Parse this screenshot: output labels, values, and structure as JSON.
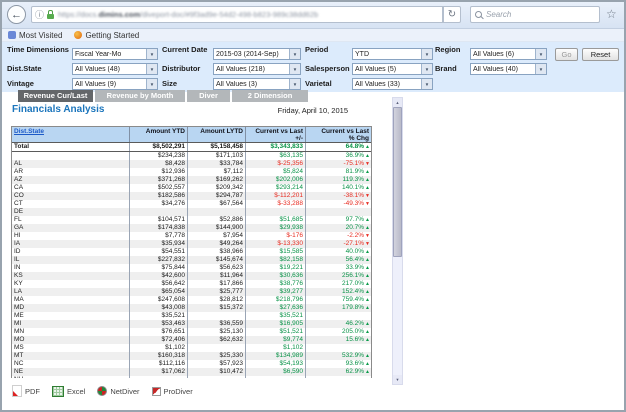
{
  "browser": {
    "url_prefix": "https://docs.",
    "url_domain": "dimins.com",
    "url_rest": "/diveport-doc/#9f3ad9e-54d2-498-b823-989c38dd62b",
    "search_placeholder": "Search",
    "bookmarks": [
      {
        "label": "Most Visited"
      },
      {
        "label": "Getting Started"
      }
    ]
  },
  "filters": {
    "go": "Go",
    "reset": "Reset",
    "rows": [
      {
        "fields": [
          {
            "label": "Time Dimensions",
            "value": "Fiscal Year-Mo"
          },
          {
            "label": "Current Date",
            "value": "2015-03 (2014-Sep)"
          },
          {
            "label": "Period",
            "value": "YTD"
          },
          {
            "label": "Region",
            "value": "All Values (6)"
          }
        ]
      },
      {
        "fields": [
          {
            "label": "Dist.State",
            "value": "All Values (48)"
          },
          {
            "label": "Distributor",
            "value": "All Values (218)"
          },
          {
            "label": "Salesperson",
            "value": "All Values (5)"
          },
          {
            "label": "Brand",
            "value": "All Values (40)"
          }
        ]
      },
      {
        "fields": [
          {
            "label": "Vintage",
            "value": "All Values (9)"
          },
          {
            "label": "Size",
            "value": "All Values (3)"
          },
          {
            "label": "Varietal",
            "value": "All Values (33)"
          }
        ]
      }
    ]
  },
  "tabs": [
    {
      "label": "Revenue Cur/Last",
      "active": true
    },
    {
      "label": "Revenue by Month",
      "active": false
    },
    {
      "label": "Diver",
      "active": false
    },
    {
      "label": "2 Dimension",
      "active": false
    }
  ],
  "page": {
    "title": "Financials Analysis",
    "date": "Friday, April 10, 2015"
  },
  "table": {
    "headers": [
      "Dist.State",
      "Amount YTD",
      "Amount LYTD",
      "Current vs Last\n+/-",
      "Current vs Last\n% Chg"
    ],
    "total": {
      "label": "Total",
      "ytd": "$8,502,291",
      "lytd": "$5,158,458",
      "diff": "$3,343,833",
      "pct": "64.8%",
      "dir": "up"
    },
    "rows": [
      {
        "label": "",
        "ytd": "$234,238",
        "lytd": "$171,103",
        "diff": "$63,135",
        "pct": "36.9%",
        "dir": "up"
      },
      {
        "label": "AL",
        "ytd": "$8,428",
        "lytd": "$33,784",
        "diff": "$-25,356",
        "pct": "-75.1%",
        "dir": "down"
      },
      {
        "label": "AR",
        "ytd": "$12,936",
        "lytd": "$7,112",
        "diff": "$5,824",
        "pct": "81.9%",
        "dir": "up"
      },
      {
        "label": "AZ",
        "ytd": "$371,268",
        "lytd": "$169,262",
        "diff": "$202,006",
        "pct": "119.3%",
        "dir": "up"
      },
      {
        "label": "CA",
        "ytd": "$502,557",
        "lytd": "$209,342",
        "diff": "$293,214",
        "pct": "140.1%",
        "dir": "up"
      },
      {
        "label": "CO",
        "ytd": "$182,586",
        "lytd": "$294,787",
        "diff": "$-112,201",
        "pct": "-38.1%",
        "dir": "down"
      },
      {
        "label": "CT",
        "ytd": "$34,276",
        "lytd": "$67,564",
        "diff": "$-33,288",
        "pct": "-49.3%",
        "dir": "down"
      },
      {
        "label": "DE",
        "ytd": "",
        "lytd": "",
        "diff": "",
        "pct": "",
        "dir": ""
      },
      {
        "label": "FL",
        "ytd": "$104,571",
        "lytd": "$52,886",
        "diff": "$51,685",
        "pct": "97.7%",
        "dir": "up"
      },
      {
        "label": "GA",
        "ytd": "$174,838",
        "lytd": "$144,900",
        "diff": "$29,938",
        "pct": "20.7%",
        "dir": "up"
      },
      {
        "label": "HI",
        "ytd": "$7,778",
        "lytd": "$7,954",
        "diff": "$-176",
        "pct": "-2.2%",
        "dir": "down"
      },
      {
        "label": "IA",
        "ytd": "$35,934",
        "lytd": "$49,264",
        "diff": "$-13,330",
        "pct": "-27.1%",
        "dir": "down"
      },
      {
        "label": "ID",
        "ytd": "$54,551",
        "lytd": "$38,966",
        "diff": "$15,585",
        "pct": "40.0%",
        "dir": "up"
      },
      {
        "label": "IL",
        "ytd": "$227,832",
        "lytd": "$145,674",
        "diff": "$82,158",
        "pct": "56.4%",
        "dir": "up"
      },
      {
        "label": "IN",
        "ytd": "$75,844",
        "lytd": "$56,623",
        "diff": "$19,221",
        "pct": "33.9%",
        "dir": "up"
      },
      {
        "label": "KS",
        "ytd": "$42,600",
        "lytd": "$11,964",
        "diff": "$30,636",
        "pct": "256.1%",
        "dir": "up"
      },
      {
        "label": "KY",
        "ytd": "$56,642",
        "lytd": "$17,866",
        "diff": "$38,776",
        "pct": "217.0%",
        "dir": "up"
      },
      {
        "label": "LA",
        "ytd": "$65,054",
        "lytd": "$25,777",
        "diff": "$39,277",
        "pct": "152.4%",
        "dir": "up"
      },
      {
        "label": "MA",
        "ytd": "$247,608",
        "lytd": "$28,812",
        "diff": "$218,796",
        "pct": "759.4%",
        "dir": "up"
      },
      {
        "label": "MD",
        "ytd": "$43,008",
        "lytd": "$15,372",
        "diff": "$27,636",
        "pct": "179.8%",
        "dir": "up"
      },
      {
        "label": "ME",
        "ytd": "$35,521",
        "lytd": "",
        "diff": "$35,521",
        "pct": "",
        "dir": ""
      },
      {
        "label": "MI",
        "ytd": "$53,463",
        "lytd": "$36,559",
        "diff": "$16,905",
        "pct": "46.2%",
        "dir": "up"
      },
      {
        "label": "MN",
        "ytd": "$76,651",
        "lytd": "$25,130",
        "diff": "$51,521",
        "pct": "205.0%",
        "dir": "up"
      },
      {
        "label": "MO",
        "ytd": "$72,406",
        "lytd": "$62,632",
        "diff": "$9,774",
        "pct": "15.6%",
        "dir": "up"
      },
      {
        "label": "MS",
        "ytd": "$1,102",
        "lytd": "",
        "diff": "$1,102",
        "pct": "",
        "dir": ""
      },
      {
        "label": "MT",
        "ytd": "$160,318",
        "lytd": "$25,330",
        "diff": "$134,989",
        "pct": "532.9%",
        "dir": "up"
      },
      {
        "label": "NC",
        "ytd": "$112,116",
        "lytd": "$57,923",
        "diff": "$54,193",
        "pct": "93.6%",
        "dir": "up"
      },
      {
        "label": "NE",
        "ytd": "$17,062",
        "lytd": "$10,472",
        "diff": "$6,590",
        "pct": "62.9%",
        "dir": "up"
      }
    ],
    "partial_row": {
      "label": "NH",
      "ytd": "",
      "lytd": "",
      "diff": "",
      "pct": "",
      "dir": ""
    }
  },
  "footer": {
    "links": [
      {
        "label": "PDF",
        "icon": "pdf-icon"
      },
      {
        "label": "Excel",
        "icon": "excel-icon"
      },
      {
        "label": "NetDiver",
        "icon": "netdiver-icon"
      },
      {
        "label": "ProDiver",
        "icon": "prodiver-icon"
      }
    ]
  }
}
